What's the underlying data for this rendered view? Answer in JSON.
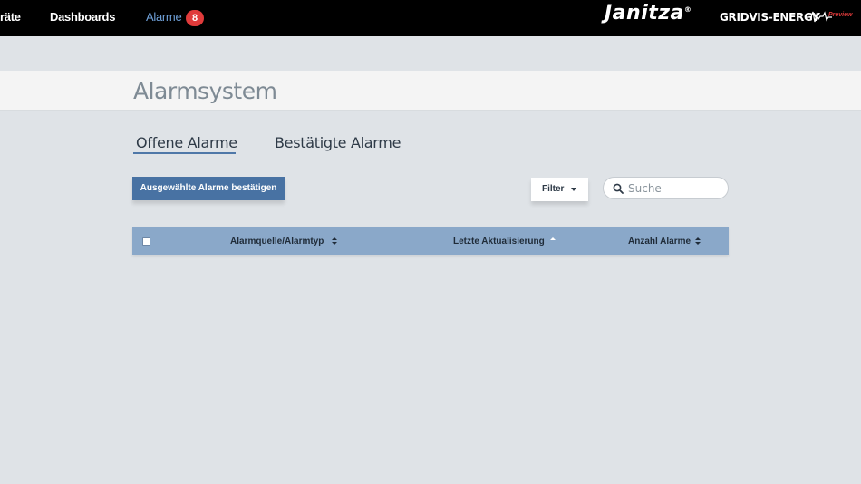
{
  "nav": {
    "items": [
      {
        "label": "räte"
      },
      {
        "label": "Dashboards"
      },
      {
        "label": "Alarme"
      }
    ],
    "alarm_badge": "8",
    "brand": "Janitza",
    "brand_mark": "®",
    "product": "GRIDVIS-ENERGY",
    "preview": "Preview"
  },
  "page": {
    "title": "Alarmsystem"
  },
  "tabs": [
    {
      "label": "Offene Alarme",
      "active": true
    },
    {
      "label": "Bestätigte Alarme",
      "active": false
    }
  ],
  "toolbar": {
    "confirm_label": "Ausgewählte Alarme bestätigen",
    "filter_label": "Filter",
    "search_placeholder": "Suche"
  },
  "table": {
    "columns": [
      {
        "label": "Alarmquelle/Alarmtyp",
        "sort": "both"
      },
      {
        "label": "Letzte Aktualisierung",
        "sort": "asc"
      },
      {
        "label": "Anzahl Alarme",
        "sort": "both"
      }
    ]
  },
  "colors": {
    "topbar": "#000000",
    "accent": "#4872a3",
    "badge": "#e03b3b",
    "table_header": "#8aa8c9"
  }
}
